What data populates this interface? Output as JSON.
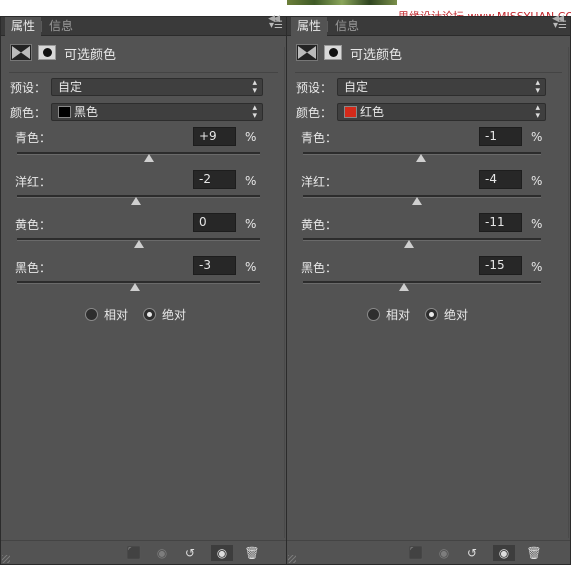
{
  "watermark": "思缘设计论坛 www.MISSYUAN.COM",
  "panels": [
    {
      "tabs": {
        "active": "属性",
        "inactive": "信息"
      },
      "title": "可选颜色",
      "preset": {
        "label": "预设：",
        "value": "自定"
      },
      "color": {
        "label": "颜色：",
        "value": "黑色",
        "swatch": "#000000"
      },
      "sliders": [
        {
          "label": "青色：",
          "value": "+9",
          "unit": "%",
          "level": 9
        },
        {
          "label": "洋红：",
          "value": "-2",
          "unit": "%",
          "level": -2
        },
        {
          "label": "黄色：",
          "value": "0",
          "unit": "%",
          "level": 0
        },
        {
          "label": "黑色：",
          "value": "-3",
          "unit": "%",
          "level": -3
        }
      ],
      "mode": {
        "relative": "相对",
        "absolute": "绝对",
        "selected": "absolute"
      }
    },
    {
      "tabs": {
        "active": "属性",
        "inactive": "信息"
      },
      "title": "可选颜色",
      "preset": {
        "label": "预设：",
        "value": "自定"
      },
      "color": {
        "label": "颜色：",
        "value": "红色",
        "swatch": "#d42a1a"
      },
      "sliders": [
        {
          "label": "青色：",
          "value": "-1",
          "unit": "%",
          "level": -1
        },
        {
          "label": "洋红：",
          "value": "-4",
          "unit": "%",
          "level": -4
        },
        {
          "label": "黄色：",
          "value": "-11",
          "unit": "%",
          "level": -11
        },
        {
          "label": "黑色：",
          "value": "-15",
          "unit": "%",
          "level": -15
        }
      ],
      "mode": {
        "relative": "相对",
        "absolute": "绝对",
        "selected": "absolute"
      }
    }
  ],
  "footer_icons": [
    "clip-to-layer-icon",
    "view-previous-state-icon",
    "reset-icon",
    "visibility-eye-icon",
    "trash-icon"
  ]
}
